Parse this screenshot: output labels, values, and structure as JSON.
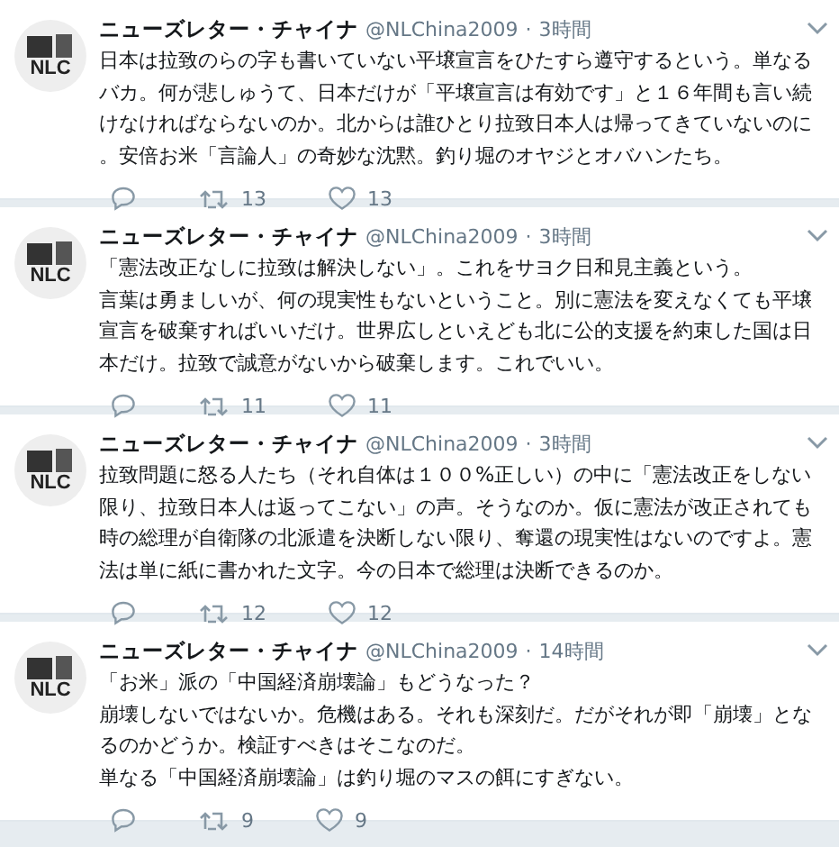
{
  "tweets": [
    {
      "avatar_text": "NLC",
      "name": "ニューズレター・チャイナ",
      "handle": "@NLChina2009",
      "separator": "·",
      "time": "3時間",
      "paragraphs": [
        "日本は拉致のらの字も書いていない平壌宣言をひたすら遵守するという。単なるバカ。何が悲しゅうて、日本だけが「平壌宣言は有効です」と１６年間も言い続けなければならないのか。北からは誰ひとり拉致日本人は帰ってきていないのに。安倍お米「言論人」の奇妙な沈黙。釣り堀のオヤジとオバハンたち。"
      ],
      "retweets": "13",
      "likes": "13"
    },
    {
      "avatar_text": "NLC",
      "name": "ニューズレター・チャイナ",
      "handle": "@NLChina2009",
      "separator": "·",
      "time": "3時間",
      "paragraphs": [
        "「憲法改正なしに拉致は解決しない」。これをサヨク日和見主義という。",
        "言葉は勇ましいが、何の現実性もないということ。別に憲法を変えなくても平壌宣言を破棄すればいいだけ。世界広しといえども北に公的支援を約束した国は日本だけ。拉致で誠意がないから破棄します。これでいい。"
      ],
      "retweets": "11",
      "likes": "11"
    },
    {
      "avatar_text": "NLC",
      "name": "ニューズレター・チャイナ",
      "handle": "@NLChina2009",
      "separator": "·",
      "time": "3時間",
      "paragraphs": [
        "拉致問題に怒る人たち（それ自体は１００%正しい）の中に「憲法改正をしない限り、拉致日本人は返ってこない」の声。そうなのか。仮に憲法が改正されても時の総理が自衛隊の北派遣を決断しない限り、奪還の現実性はないのですよ。憲法は単に紙に書かれた文字。今の日本で総理は決断できるのか。"
      ],
      "retweets": "12",
      "likes": "12"
    },
    {
      "avatar_text": "NLC",
      "name": "ニューズレター・チャイナ",
      "handle": "@NLChina2009",
      "separator": "·",
      "time": "14時間",
      "paragraphs": [
        "「お米」派の「中国経済崩壊論」もどうなった？",
        "崩壊しないではないか。危機はある。それも深刻だ。だがそれが即「崩壊」となるのかどうか。検証すべきはそこなのだ。",
        "単なる「中国経済崩壊論」は釣り堀のマスの餌にすぎない。"
      ],
      "retweets": "9",
      "likes": "9"
    }
  ]
}
